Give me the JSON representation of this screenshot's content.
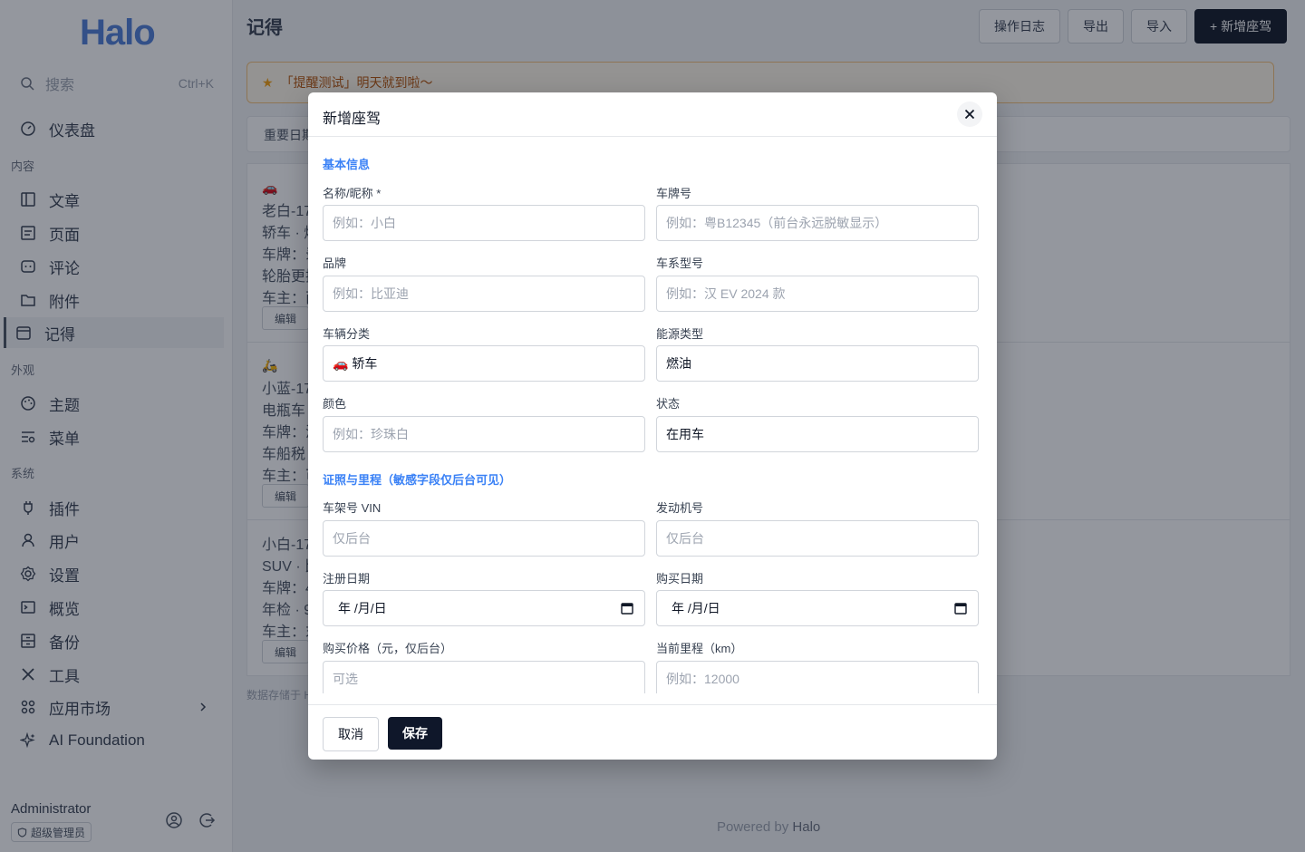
{
  "sidebar": {
    "logo": "Halo",
    "search": {
      "placeholder": "搜索",
      "shortcut": "Ctrl+K"
    },
    "dashboard": "仪表盘",
    "groups": {
      "content": "内容",
      "appearance": "外观",
      "system": "系统"
    },
    "content_items": [
      "文章",
      "页面",
      "评论",
      "附件",
      "记得"
    ],
    "appearance_items": [
      "主题",
      "菜单"
    ],
    "system_items": [
      "插件",
      "用户",
      "设置",
      "概览",
      "备份",
      "工具",
      "应用市场",
      "AI Foundation"
    ],
    "user": {
      "name": "Administrator",
      "role": "超级管理员"
    }
  },
  "main": {
    "title": "记得",
    "actions": {
      "log": "操作日志",
      "export": "导出",
      "import": "导入",
      "add": "+ 新增座驾"
    },
    "notice": "「提醒测试」明天就到啦～",
    "tab": "重要日期",
    "cards": [
      {
        "emoji": "🚗",
        "name": "老白-17",
        "type": "轿车 · 燃",
        "plate": "车牌：录",
        "remark": "轮胎更换",
        "owner": "车主：西",
        "edit": "编辑"
      },
      {
        "emoji": "🛵",
        "name": "小蓝-17",
        "type": "电瓶车",
        "plate": "车牌：沪",
        "remark": "车船税",
        "owner": "车主：可",
        "edit": "编辑"
      },
      {
        "emoji": "",
        "name": "小白-17",
        "type": "SUV · 比",
        "plate": "车牌：4",
        "remark": "年检 · 9",
        "owner": "车主：末",
        "edit": "编辑"
      }
    ],
    "footnote": "数据存储于 H",
    "powered_prefix": "Powered by",
    "powered_brand": "Halo"
  },
  "modal": {
    "title": "新增座驾",
    "sections": {
      "basic": "基本信息",
      "license": "证照与里程（敏感字段仅后台可见）"
    },
    "fields": {
      "name": {
        "label": "名称/昵称 *",
        "placeholder": "例如：小白"
      },
      "plate": {
        "label": "车牌号",
        "placeholder": "例如：粤B12345（前台永远脱敏显示）"
      },
      "brand": {
        "label": "品牌",
        "placeholder": "例如：比亚迪"
      },
      "model": {
        "label": "车系型号",
        "placeholder": "例如：汉 EV 2024 款"
      },
      "category": {
        "label": "车辆分类",
        "value": "🚗 轿车"
      },
      "energy": {
        "label": "能源类型",
        "value": "燃油"
      },
      "color": {
        "label": "颜色",
        "placeholder": "例如：珍珠白"
      },
      "status": {
        "label": "状态",
        "value": "在用车"
      },
      "vin": {
        "label": "车架号 VIN",
        "placeholder": "仅后台"
      },
      "engine": {
        "label": "发动机号",
        "placeholder": "仅后台"
      },
      "reg_date": {
        "label": "注册日期",
        "value": "年 /月/日"
      },
      "buy_date": {
        "label": "购买日期",
        "value": "年 /月/日"
      },
      "price": {
        "label": "购买价格（元，仅后台）",
        "placeholder": "可选"
      },
      "mileage": {
        "label": "当前里程（km）",
        "placeholder": "例如：12000"
      }
    },
    "buttons": {
      "cancel": "取消",
      "save": "保存"
    }
  }
}
